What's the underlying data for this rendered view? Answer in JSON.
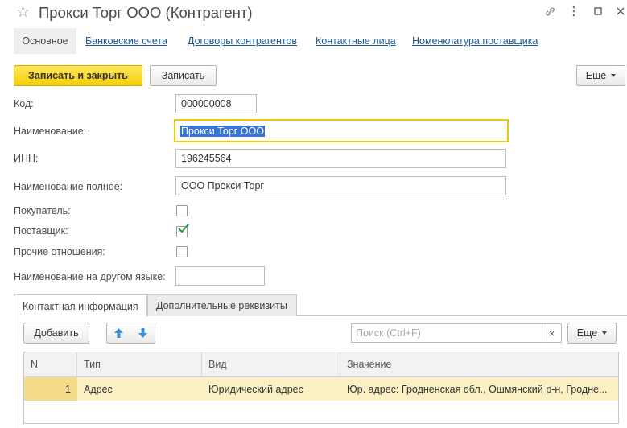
{
  "window": {
    "title": "Прокси Торг ООО (Контрагент)",
    "star_glyph": "☆",
    "link_glyph": "🔗",
    "menu_glyph": "⋮",
    "minimize_glyph": "▫",
    "maximize_glyph": "□",
    "close_glyph": "✕"
  },
  "nav": {
    "active": "Основное",
    "links": [
      "Банковские счета",
      "Договоры контрагентов",
      "Контактные лица",
      "Номенклатура поставщика"
    ]
  },
  "toolbar": {
    "save_close": "Записать и закрыть",
    "save": "Записать",
    "more": "Еще"
  },
  "form": {
    "code_label": "Код:",
    "code_value": "000000008",
    "name_label": "Наименование:",
    "name_value": "Прокси Торг ООО",
    "inn_label": "ИНН:",
    "inn_value": "196245564",
    "full_name_label": "Наименование полное:",
    "full_name_value": "ООО Прокси Торг",
    "buyer_label": "Покупатель:",
    "buyer_checked": false,
    "supplier_label": "Поставщик:",
    "supplier_checked": true,
    "other_label": "Прочие отношения:",
    "other_checked": false,
    "foreign_name_label": "Наименование на другом языке:",
    "foreign_name_value": ""
  },
  "tabs": [
    "Контактная информация",
    "Дополнительные реквизиты"
  ],
  "contact": {
    "add_button": "Добавить",
    "search_placeholder": "Поиск (Ctrl+F)",
    "clear_glyph": "×",
    "more": "Еще",
    "columns": [
      "N",
      "Тип",
      "Вид",
      "Значение"
    ],
    "rows": [
      {
        "n": "1",
        "type": "Адрес",
        "kind": "Юридический адрес",
        "value": "Юр. адрес: Гродненская обл., Ошмянский р-н, Гродненская"
      }
    ]
  },
  "colors": {
    "accent_yellow": "#f5cf07",
    "link_blue": "#1c5a96",
    "selection_blue": "#3875d7",
    "check_green": "#2e9a4a",
    "row_highlight": "#fbf0c4"
  }
}
